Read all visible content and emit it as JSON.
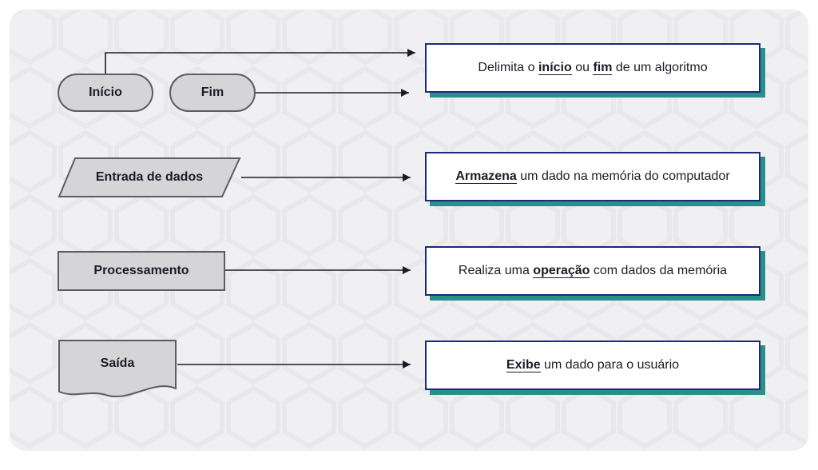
{
  "shapes": {
    "inicio": "Início",
    "fim": "Fim",
    "entrada": "Entrada de dados",
    "processamento": "Processamento",
    "saida": "Saída"
  },
  "descriptions": {
    "terminator_pre": "Delimita o ",
    "terminator_kw1": "início",
    "terminator_mid": " ou ",
    "terminator_kw2": "fim",
    "terminator_post": " de um algoritmo",
    "entrada_kw": "Armazena",
    "entrada_post": " um dado na memória do computador",
    "proc_pre": "Realiza uma ",
    "proc_kw": "operação",
    "proc_post": " com dados da memória",
    "saida_kw": "Exibe",
    "saida_post": " um dado para o usuário"
  }
}
